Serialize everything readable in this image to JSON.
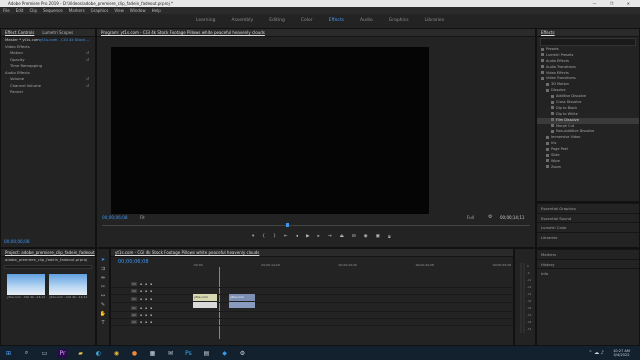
{
  "title_bar": {
    "title": "Adobe Premiere Pro 2019 - D:\\Videos\\adobe_premiere_clip_fadein_fadeout.prproj *",
    "controls": "—  ❐  ✕"
  },
  "menu": [
    "File",
    "Edit",
    "Clip",
    "Sequence",
    "Markers",
    "Graphics",
    "View",
    "Window",
    "Help"
  ],
  "workspaces": [
    "Learning",
    "Assembly",
    "Editing",
    "Color",
    "Effects",
    "Audio",
    "Graphics",
    "Libraries"
  ],
  "workspace_active": "Effects",
  "effect_controls": {
    "tabs": [
      "Effect Controls",
      "Lumetri Scopes"
    ],
    "source": "Master * yt1s.com",
    "clip": "yt1s.com - CGI 4k Stock...",
    "rows": [
      "Video Effects",
      "Motion",
      "Opacity",
      "Time Remapping",
      "Audio Effects",
      "Volume",
      "Channel Volume",
      "Panner"
    ]
  },
  "program": {
    "title": "Program: yt1s.com - CGI 4k Stock Footage   Pillows white peaceful heavenly clouds",
    "timecode_left": "00;00;06;08",
    "zoom": "Fit",
    "quality": "Full",
    "timecode_right": "00;00;14;11"
  },
  "effects": {
    "title": "Effects",
    "items": [
      "Presets",
      "Lumetri Presets",
      "Audio Effects",
      "Audio Transitions",
      "Video Effects",
      "Video Transitions",
      "3D Motion",
      "Dissolve",
      "Additive Dissolve",
      "Cross Dissolve",
      "Dip to Black",
      "Dip to White",
      "Film Dissolve",
      "Morph Cut",
      "Non-Additive Dissolve",
      "Immersive Video",
      "Iris",
      "Page Peel",
      "Slide",
      "Wipe",
      "Zoom"
    ],
    "selected": "Film Dissolve",
    "subpanels": [
      "Essential Graphics",
      "Essential Sound",
      "Lumetri Color",
      "Libraries",
      "Markers",
      "History",
      "Info"
    ]
  },
  "project": {
    "tabs": [
      "Project: adobe_premiere_clip_fadein_fadeout"
    ],
    "file": "adobe_premiere_clip_fadein_fadeout.prproj",
    "items": [
      {
        "name": "yt1s.com - CGI 4k...",
        "duration": "14;11"
      },
      {
        "name": "yt1s.com - CGI 4k...",
        "duration": "14;11"
      }
    ]
  },
  "timeline": {
    "tab": "yt1s.com - CGI 4k Stock Footage   Pillows white peaceful heavenly clouds",
    "timecode": "00;00;06;08",
    "ruler": [
      ":00;00",
      "00;00;14;29",
      "00;00;29;29",
      "00;00;44;28",
      "00;00;59;28"
    ],
    "tracks": [
      "V3",
      "V2",
      "V1",
      "A1",
      "A2",
      "A3"
    ],
    "clip_labels": [
      "yt1s.com",
      "yt1s.com"
    ]
  },
  "meters": [
    "0",
    "-6",
    "-12",
    "-18",
    "-24",
    "-30",
    "-36",
    "-42",
    "-48",
    "-54"
  ],
  "taskbar": {
    "time": "10:27 AM",
    "date": "3/4/2022"
  },
  "colors": {
    "accent": "#3d95f0",
    "clip_video": "#7d8fb3",
    "clip_sel": "#d8d8b0"
  }
}
